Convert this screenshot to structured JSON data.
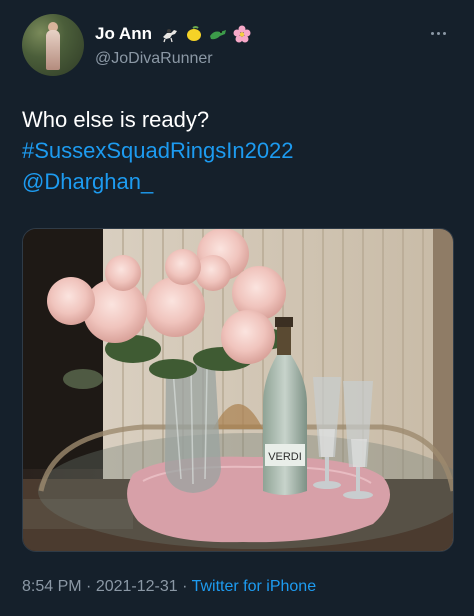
{
  "user": {
    "display_name": "Jo Ann",
    "handle": "@JoDivaRunner",
    "name_emojis": [
      "horse-racing-emoji",
      "lemon-emoji",
      "crocodile-emoji",
      "cherry-blossom-emoji"
    ]
  },
  "tweet": {
    "text_line1": "Who else is ready?",
    "hashtag": "#SussexSquadRingsIn2022",
    "mention": "@Dharghan_"
  },
  "media": {
    "bottle_label": "VERDI"
  },
  "meta": {
    "time": "8:54 PM",
    "separator": " · ",
    "date": "2021-12-31",
    "source": "Twitter for iPhone"
  },
  "colors": {
    "background": "#15202b",
    "text": "#ffffff",
    "secondary": "#8b98a5",
    "link": "#1d9bf0"
  },
  "icons": {
    "more": "more-dots-icon"
  }
}
